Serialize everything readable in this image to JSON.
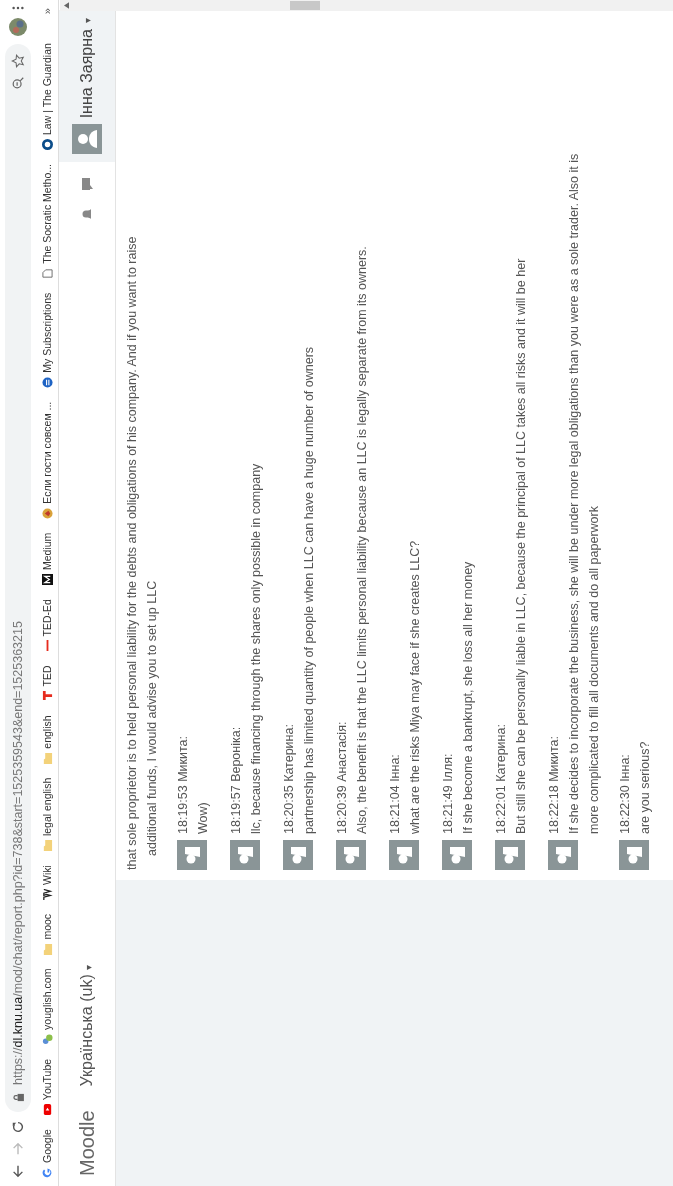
{
  "browser": {
    "url": "https://**dl.knu.ua**/mod/chat/report.php?id=738&start=1525359543&end=1525363215",
    "bookmarks": [
      {
        "label": "Google",
        "kind": "google"
      },
      {
        "label": "YouTube",
        "kind": "youtube"
      },
      {
        "label": "youglish.com",
        "kind": "youglish"
      },
      {
        "label": "mooc",
        "kind": "folder"
      },
      {
        "label": "Wiki",
        "kind": "wiki"
      },
      {
        "label": "legal english",
        "kind": "folder"
      },
      {
        "label": "english",
        "kind": "folder"
      },
      {
        "label": "TED",
        "kind": "ted"
      },
      {
        "label": "TED-Ed",
        "kind": "teded"
      },
      {
        "label": "Medium",
        "kind": "medium"
      },
      {
        "label": "Если гости совсем ...",
        "kind": "bird"
      },
      {
        "label": "My Subscriptions",
        "kind": "subs"
      },
      {
        "label": "The Socratic Metho...",
        "kind": "doc"
      },
      {
        "label": "Law | The Guardian",
        "kind": "guardian"
      }
    ],
    "overflow": "»"
  },
  "navbar": {
    "brand": "Moodle",
    "language": "Українська (uk)",
    "language_caret": "▾",
    "user": "Інна Заярна",
    "user_caret": "▾"
  },
  "chat": {
    "continuation": [
      "that sole proprietor is to held personal liability for the debts and obligations of his company. And if you want to raise",
      "additional funds, I would advise you to set up LLC"
    ],
    "messages": [
      {
        "header": "18:19:53 Микита:",
        "lines": [
          "Wow)"
        ]
      },
      {
        "header": "18:19:57 Вероніка:",
        "lines": [
          "llc, because financing through the shares only possible in company"
        ]
      },
      {
        "header": "18:20:35 Катерина:",
        "lines": [
          "partnership has limited quantity of people when LLC can have a huge number of owners"
        ]
      },
      {
        "header": "18:20:39 Анастасія:",
        "lines": [
          "Also, the benefit is that the LLC limits personal liability because an LLC is legally separate from its owners."
        ]
      },
      {
        "header": "18:21:04 Інна:",
        "lines": [
          "what are the risks Miya may face if she creates LLC?"
        ]
      },
      {
        "header": "18:21:49 Ілля:",
        "lines": [
          "If she become a bankrupt, she loss all her money"
        ]
      },
      {
        "header": "18:22:01 Катерина:",
        "lines": [
          "But still she can be personally liable in LLC, because the principal of LLC takes all risks and it will be her"
        ]
      },
      {
        "header": "18:22:18 Микита:",
        "lines": [
          "If she decides to incorporate the business, she will be under more legal obligations than you were as a sole trader. Also it is",
          "more complicated to fill all documents and do all paperwork"
        ]
      },
      {
        "header": "18:22:30 Інна:",
        "lines": [
          "are you serious?"
        ]
      }
    ]
  }
}
